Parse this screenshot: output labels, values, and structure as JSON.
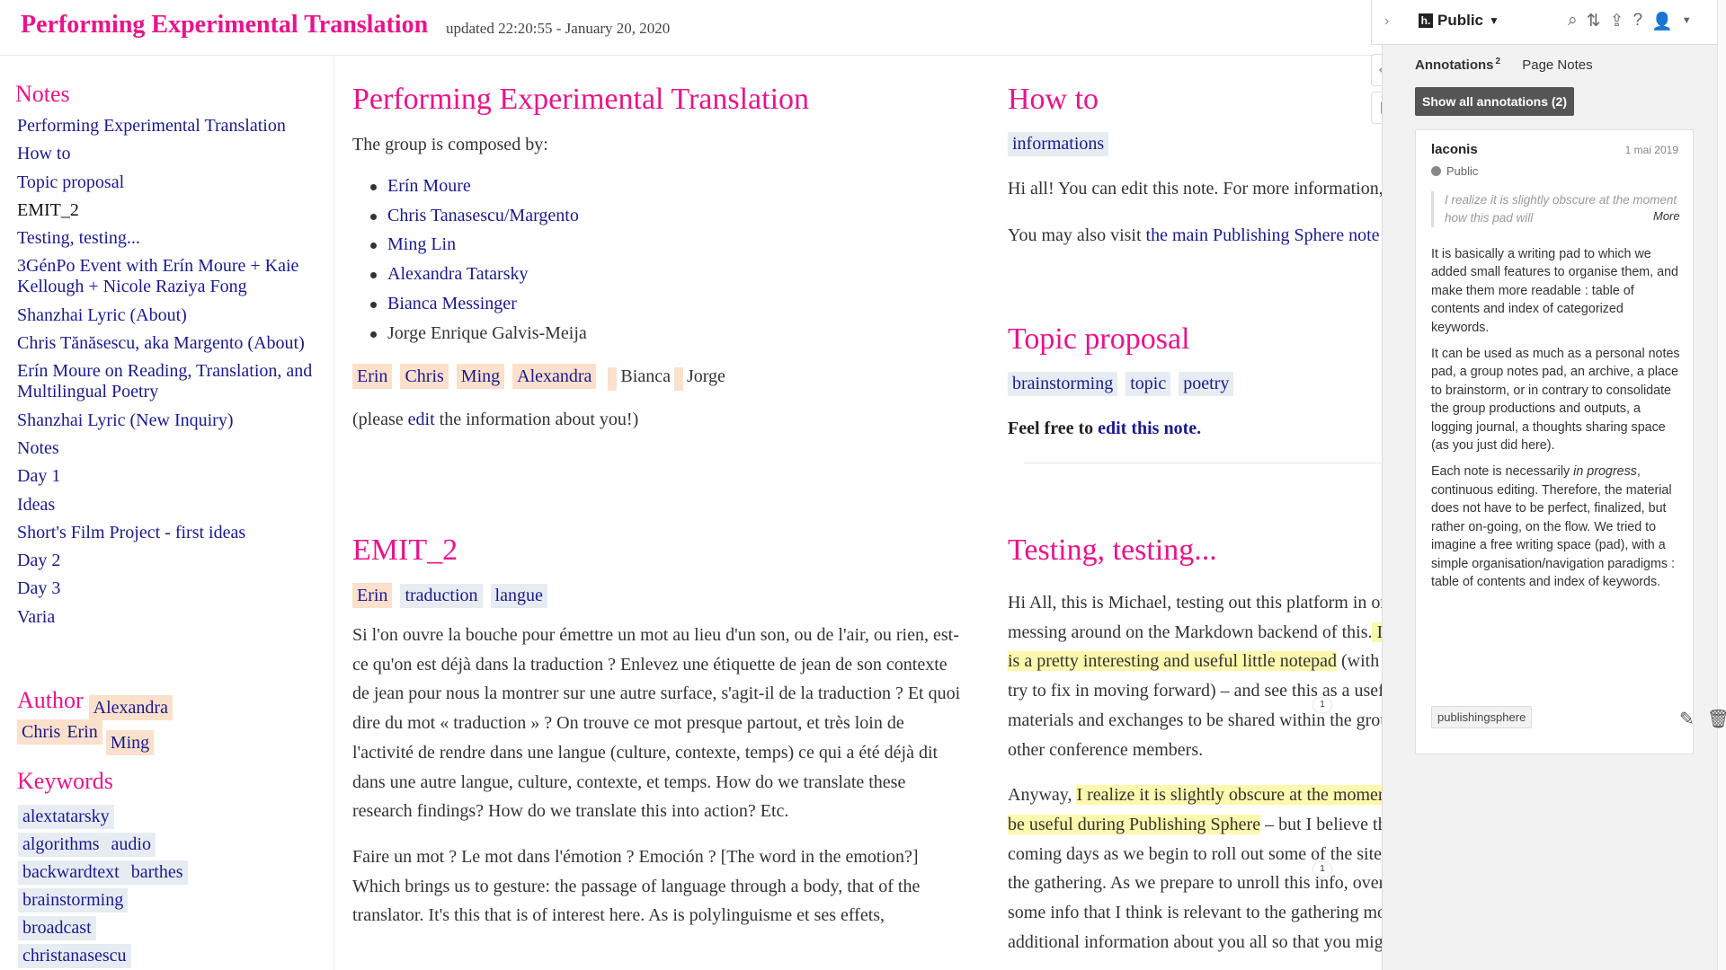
{
  "header": {
    "title": "Performing Experimental Translation",
    "updated": "updated 22:20:55 - January 20, 2020"
  },
  "sidebar": {
    "notes_heading": "Notes",
    "items": [
      {
        "label": "Performing Experimental Translation"
      },
      {
        "label": "How to"
      },
      {
        "label": "Topic proposal"
      },
      {
        "label": "EMIT_2"
      },
      {
        "label": "Testing, testing..."
      },
      {
        "label": "3GénPo Event with Erín Moure + Kaie Kellough + Nicole Raziya Fong"
      },
      {
        "label": "Shanzhai Lyric (About)"
      },
      {
        "label": "Chris Tănăsescu, aka Margento (About)"
      },
      {
        "label": "Erín Moure on Reading, Translation, and Multilingual Poetry"
      },
      {
        "label": "Shanzhai Lyric (New Inquiry)"
      },
      {
        "label": "Notes"
      },
      {
        "label": "Day 1"
      },
      {
        "label": "Ideas"
      },
      {
        "label": "Short's Film Project - first ideas"
      },
      {
        "label": "Day 2"
      },
      {
        "label": "Day 3"
      },
      {
        "label": "Varia"
      }
    ],
    "author_heading": "Author",
    "authors": [
      "Alexandra",
      "Chris",
      "Erin",
      "Ming"
    ],
    "keywords_heading": "Keywords",
    "keywords": [
      "alextatarsky",
      "algorithms",
      "audio",
      "backwardtext",
      "barthes",
      "brainstorming",
      "broadcast",
      "christanasescu"
    ]
  },
  "main": {
    "pet": {
      "title": "Performing Experimental Translation",
      "intro": "The group is composed by:",
      "members": [
        "Erín Moure",
        "Chris Tanasescu/Margento",
        "Ming Lin",
        "Alexandra Tatarsky",
        "Bianca Messinger",
        "Jorge Enrique Galvis-Meija"
      ],
      "tags": [
        "Erin",
        "Chris",
        "Ming",
        "Alexandra"
      ],
      "plain_tags": [
        "Bianca",
        "Jorge"
      ],
      "edit_prefix": "(please ",
      "edit_link": "edit",
      "edit_suffix": " the information about you!)"
    },
    "howto": {
      "title": "How to",
      "tag": "informations",
      "p1": "Hi all! You can edit this note. For more information,",
      "p2_prefix": "You may also visit ",
      "p2_link": "the main Publishing Sphere note"
    },
    "topic": {
      "title": "Topic proposal",
      "tags": [
        "brainstorming",
        "topic",
        "poetry"
      ],
      "feel_prefix": "Feel free to ",
      "feel_link": "edit this note."
    },
    "emit": {
      "title": "EMIT_2",
      "tags": [
        "Erin"
      ],
      "kwtags": [
        "traduction",
        "langue"
      ],
      "p1": "Si l'on ouvre la bouche pour émettre un mot au lieu d'un son, ou de l'air, ou rien, est-ce qu'on est déjà dans la traduction ? Enlevez une étiquette de jean de son contexte de jean pour nous la montrer sur une autre surface, s'agit-il de la traduction ? Et quoi dire du mot « traduction » ? On trouve ce mot presque partout, et très loin de l'activité de rendre dans une langue (culture, contexte, temps) ce qui a été déjà dit dans une autre langue, culture, contexte, et temps. How do we translate these research findings? How do we translate this into action? Etc.",
      "p2": "Faire un mot ? Le mot dans l'émotion ? Emoción ? [The word in the emotion?] Which brings us to gesture: the passage of language through a body, that of the translator. It's this that is of interest here. As is polylinguisme et ses effets,"
    },
    "testing": {
      "title": "Testing, testing...",
      "p1_a": "Hi All, this is Michael, testing out this platform in or",
      "p1_b": "messing around on the Markdown backend of this.",
      "p1_hl": " I",
      "p1_c": "is a pretty interesting and useful little notepad",
      "p1_d": " (with",
      "p1_e": "try to fix in moving forward) – and see this as a usefu",
      "p1_f": "materials and exchanges to be shared within the grou",
      "p1_g": "other conference members.",
      "p2_a": "Anyway, ",
      "p2_hl": "I realize it is slightly obscure at the moment",
      "p2_hl2": "be useful during Publishing Sphere",
      "p2_b": " – but I believe th",
      "p2_c": "coming days as we begin to roll out some of the sites",
      "p2_d": "the gathering. As we prepare to unroll this info, over",
      "p2_e": "some info that I think is relevant to the gathering mo",
      "p2_f": "additional information about you all so that you mig"
    }
  },
  "hypothesis": {
    "group": "Public",
    "tab_annotations": "Annotations",
    "tab_annotations_count": "2",
    "tab_page_notes": "Page Notes",
    "show_all": "Show all annotations (2)",
    "annotation": {
      "user": "laconis",
      "date": "1 mai 2019",
      "visibility": "Public",
      "quote": "I realize it is slightly obscure at the moment how this pad will",
      "more": "More",
      "body1": "It is basically a writing pad to which we added small features to organise them, and make them more readable : table of contents and index of categorized keywords.",
      "body2": "It can be used as much as a personal notes pad, a group notes pad, an archive, a place to brainstorm, or in contrary to consolidate the group productions and outputs, a logging journal, a thoughts sharing space (as you just did here).",
      "body3_a": "Each note is necessarily ",
      "body3_em": "in progress",
      "body3_b": ", continuous editing. Therefore, the material does not have to be perfect, finalized, but rather on-going, on the flow. We tried to imagine a free writing space (pad), with a simple organisation/navigation paradigms : table of contents and index of keywords.",
      "tag": "publishingsphere"
    },
    "badge_1": "1",
    "badge_2": "1"
  }
}
